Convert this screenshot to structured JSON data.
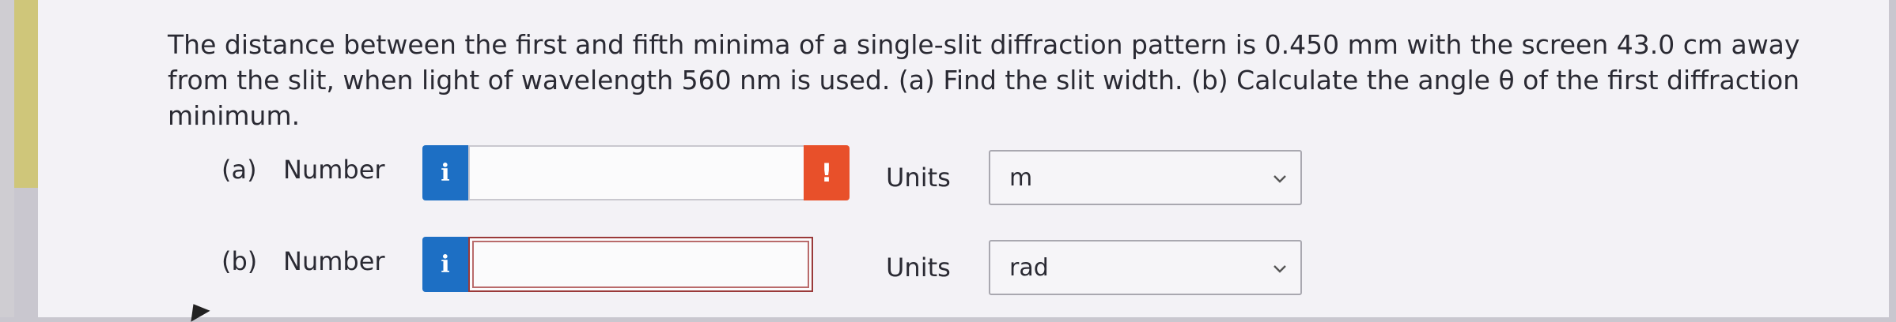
{
  "question": {
    "text": "The distance between the first and fifth minima of a single-slit diffraction pattern is 0.450 mm with the screen 43.0 cm away from the slit, when light of wavelength 560 nm is used. (a) Find the slit width. (b) Calculate the angle θ of the first diffraction minimum."
  },
  "parts": [
    {
      "part_label": "(a)",
      "number_label": "Number",
      "info_symbol": "i",
      "input_value": "",
      "alert_symbol": "!",
      "units_label": "Units",
      "units_value": "m"
    },
    {
      "part_label": "(b)",
      "number_label": "Number",
      "info_symbol": "i",
      "input_value": "",
      "units_label": "Units",
      "units_value": "rad"
    }
  ],
  "colors": {
    "info_button": "#1d6fc4",
    "alert_button": "#e8502a",
    "accent_bar": "#cfc67a"
  }
}
